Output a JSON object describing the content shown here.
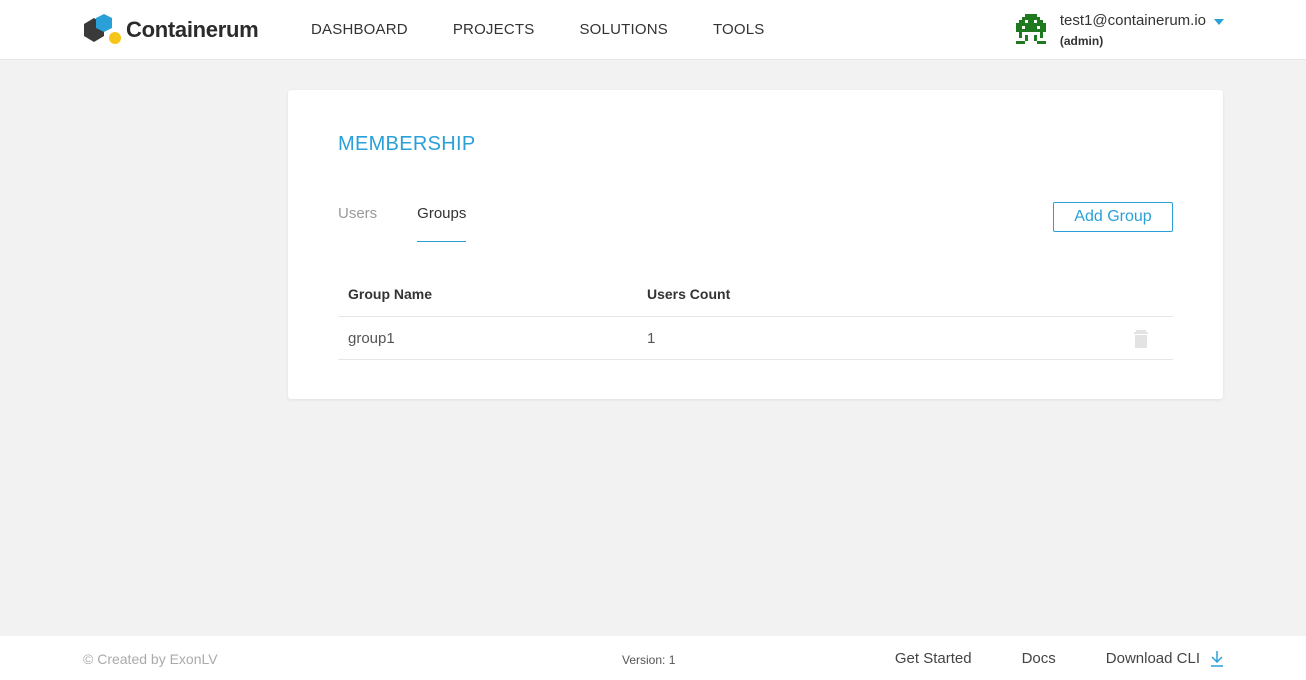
{
  "brand": {
    "name": "Containerum",
    "colors": {
      "accent": "#2aa0d8",
      "logo_dark": "#3a3a3a",
      "logo_blue": "#2aa0d8",
      "logo_yellow": "#f5c518",
      "avatar_green": "#1f7a1f"
    }
  },
  "nav": {
    "items": [
      "DASHBOARD",
      "PROJECTS",
      "SOLUTIONS",
      "TOOLS"
    ]
  },
  "user": {
    "email": "test1@containerum.io",
    "role": "(admin)",
    "avatar_icon": "pixel-invader-avatar-icon",
    "menu_icon": "caret-down-icon"
  },
  "membership": {
    "title": "MEMBERSHIP",
    "tabs": [
      {
        "label": "Users",
        "active": false
      },
      {
        "label": "Groups",
        "active": true
      }
    ],
    "add_button": "Add Group",
    "table": {
      "columns": [
        "Group Name",
        "Users Count"
      ],
      "rows": [
        {
          "name": "group1",
          "users_count": "1",
          "action_icon": "trash-icon"
        }
      ]
    }
  },
  "footer": {
    "copyright": "© Created by ExonLV",
    "version": "Version: 1",
    "links": [
      "Get Started",
      "Docs",
      "Download CLI"
    ],
    "download_icon": "download-icon"
  }
}
